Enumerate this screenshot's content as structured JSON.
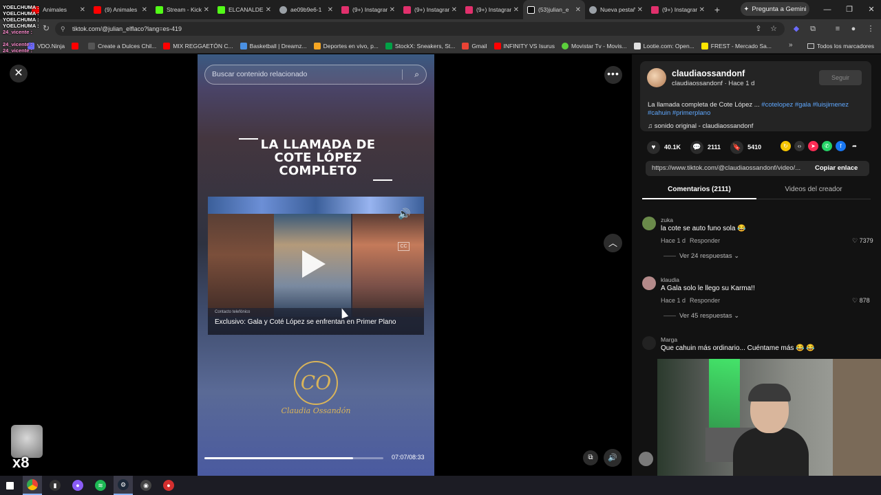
{
  "browser": {
    "tabs": [
      {
        "label": "Animales",
        "color": "#ff0000"
      },
      {
        "label": "(9) Animales",
        "color": "#ff0000"
      },
      {
        "label": "Stream - Kick",
        "color": "#53fc18"
      },
      {
        "label": "ELCANALDE",
        "color": "#53fc18"
      },
      {
        "label": "ae09b9e6-1",
        "color": "#9aa0a6"
      },
      {
        "label": "(9+) Instagram",
        "color": "#e1306c"
      },
      {
        "label": "(9+) Instagram",
        "color": "#e1306c"
      },
      {
        "label": "(9+) Instagram",
        "color": "#e1306c"
      },
      {
        "label": "(53)julian_e",
        "color": "#ffffff"
      },
      {
        "label": "Nueva pestaña",
        "color": "#9aa0a6"
      },
      {
        "label": "(9+) Instagram",
        "color": "#e1306c"
      }
    ],
    "new_tab": "+",
    "gemini_label": "Pregunta a Gemini",
    "url": "tiktok.com/@julian_elflaco?lang=es-419",
    "bookmarks": [
      {
        "label": "VDO.Ninja",
        "color": "#6b6bff"
      },
      {
        "label": "",
        "color": "#ff0000"
      },
      {
        "label": "Create a Dulces Chil...",
        "color": "#ffffff"
      },
      {
        "label": "MIX REGGAETÓN C...",
        "color": "#ff0000"
      },
      {
        "label": "Basketball | Dreamz...",
        "color": "#4a90e2"
      },
      {
        "label": "Deportes en vivo, p...",
        "color": "#f5a623"
      },
      {
        "label": "StockX: Sneakers, St...",
        "color": "#00a046"
      },
      {
        "label": "Gmail",
        "color": "#ea4335"
      },
      {
        "label": "INFINITY VS Isurus",
        "color": "#ff0000"
      },
      {
        "label": "Movistar Tv - Movis...",
        "color": "#5ccf3c"
      },
      {
        "label": "Lootie.com: Open...",
        "color": "#e0e0e0"
      },
      {
        "label": "FREST - Mercado Sa...",
        "color": "#ffe600"
      }
    ],
    "all_bookmarks": "Todos los marcadores"
  },
  "chat_overlay": [
    "YOELCHUMA :",
    "YOELCHUMA :",
    "YOELCHUMA :",
    "YOELCHUMA :",
    "24_vicente :",
    "24_vicente :",
    "24_vicente :"
  ],
  "video": {
    "search_placeholder": "Buscar contenido relacionado",
    "title_lines": [
      "LA LLAMADA DE",
      "COTE LÓPEZ",
      "COMPLETO"
    ],
    "inner_small": "Contacto telefónico",
    "inner_caption": "Exclusivo: Gala y Coté López se enfrentan en Primer Plano",
    "cc_label": "CC",
    "logo_mark": "CO",
    "logo_text": "Claudia Ossandón",
    "time": "07:07/08:33",
    "progress": 0.83
  },
  "post": {
    "username": "claudiaossandonf",
    "subline": "claudiaossandonf · Hace 1 d",
    "follow_label": "Seguir",
    "description_text": "La llamada completa de Cote López ... ",
    "hashtags_line1": "#cotelopez #gala #luisjimenez",
    "hashtags_line2": "#cahuin #primerplano",
    "sound": "sonido original - claudiaossandonf",
    "likes": "40.1K",
    "comments": "2111",
    "saves": "5410",
    "link": "https://www.tiktok.com/@claudiaossandonf/video/...",
    "copy_label": "Copiar enlace",
    "tab_comments": "Comentarios (2111)",
    "tab_videos": "Videos del creador"
  },
  "comments": [
    {
      "user": "zuka",
      "text": "la cote se auto funo sola 😂",
      "time": "Hace 1 d",
      "reply": "Responder",
      "likes": "7379",
      "more": "Ver 24 respuestas",
      "avatar_color": "#6a8a4a"
    },
    {
      "user": "klaudia",
      "text": "A Gala solo le llego su Karma!!",
      "time": "Hace 1 d",
      "reply": "Responder",
      "likes": "878",
      "more": "Ver 45 respuestas",
      "avatar_color": "#b48a8a"
    },
    {
      "user": "Marga",
      "text": "Que cahuin más ordinario... Cuéntame más 😂 😂",
      "time": "",
      "reply": "",
      "likes": "",
      "more": "",
      "avatar_color": "#222222"
    }
  ],
  "sticker_label": "x8"
}
